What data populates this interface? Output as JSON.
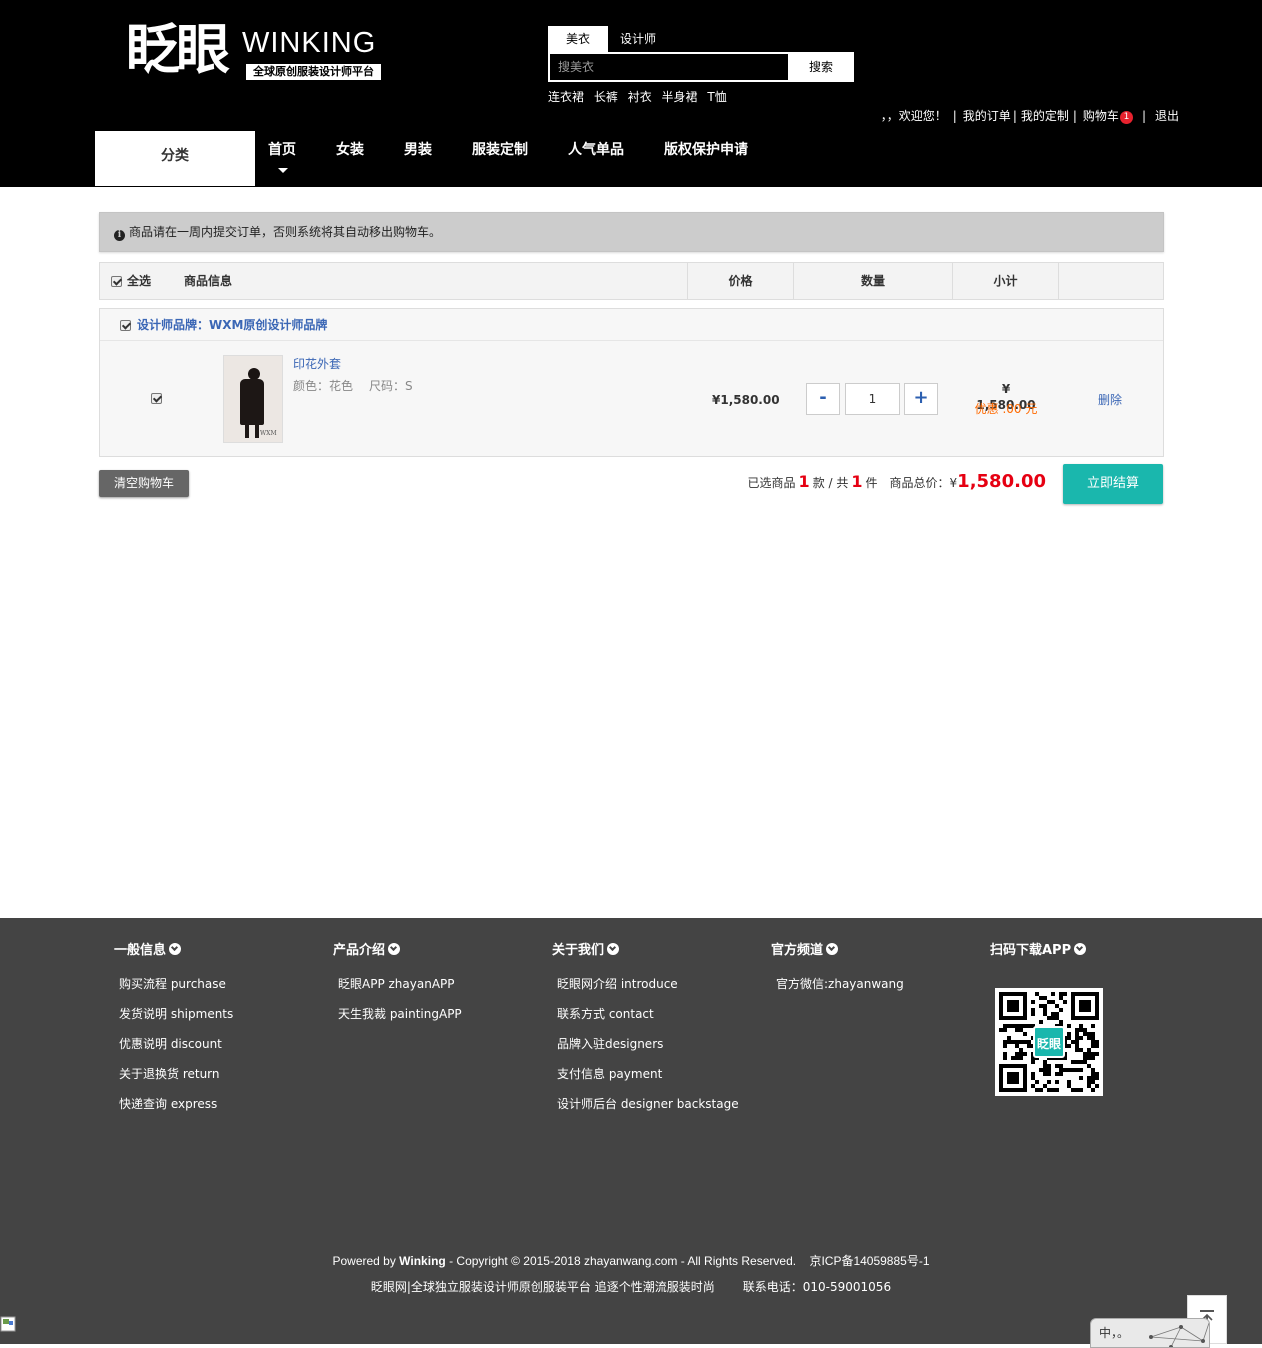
{
  "header": {
    "logo": {
      "cn": "眨眼",
      "en": "WINKING",
      "sub": "全球原创服装设计师平台"
    },
    "search": {
      "tabs": [
        "美衣",
        "设计师"
      ],
      "placeholder": "搜美衣",
      "button": "搜索",
      "hot_words": [
        "连衣裙",
        "长裤",
        "衬衣",
        "半身裙",
        "T恤"
      ]
    },
    "user_bar": {
      "welcome": "，，欢迎您！",
      "links": [
        "我的订单",
        "我的定制",
        "购物车",
        "退出"
      ],
      "cart_count": "1"
    },
    "nav": {
      "category": "分类",
      "items": [
        "首页",
        "女装",
        "男装",
        "服装定制",
        "人气单品",
        "版权保护申请"
      ]
    }
  },
  "cart": {
    "notice": "商品请在一周内提交订单，否则系统将其自动移出购物车。",
    "columns": {
      "select_all": "全选",
      "info": "商品信息",
      "price": "价格",
      "quantity": "数量",
      "subtotal": "小计"
    },
    "shop": {
      "name": "设计师品牌：WXM原创设计师品牌",
      "items": [
        {
          "name": "印花外套",
          "color": "颜色：花色",
          "size": "尺码：S",
          "price": "¥1,580.00",
          "quantity": "1",
          "subtotal": "¥ 1,580.00",
          "discount": "优惠 .00 元",
          "delete": "删除",
          "image_mark": "WXM"
        }
      ]
    },
    "qty_minus": "-",
    "qty_plus": "+",
    "clear_button": "清空购物车",
    "summary": {
      "selected_label": "已选商品",
      "selected_count": "1",
      "kinds_label": "款 / 共",
      "total_count": "1",
      "pieces_label": "件",
      "total_label": "商品总价：¥",
      "total_value": "1,580.00"
    },
    "checkout_button": "立即结算"
  },
  "footer": {
    "columns": [
      {
        "title": "一般信息",
        "links": [
          "购买流程 purchase",
          "发货说明 shipments",
          "优惠说明 discount",
          "关于退换货 return",
          "快递查询 express"
        ]
      },
      {
        "title": "产品介绍",
        "links": [
          "眨眼APP zhayanAPP",
          "天生我裁 paintingAPP"
        ]
      },
      {
        "title": "关于我们",
        "links": [
          "眨眼网介绍 introduce",
          "联系方式 contact",
          "品牌入驻designers",
          "支付信息 payment",
          "设计师后台 designer backstage"
        ]
      },
      {
        "title": "官方频道",
        "links": [
          "官方微信:zhayanwang"
        ]
      },
      {
        "title": "扫码下载APP",
        "links": []
      }
    ],
    "qr_label": "眨眼",
    "copyright": {
      "prefix": "Powered by ",
      "brand": "Winking",
      "rest": " - Copyright © 2015-2018 zhayanwang.com - All Rights Reserved.",
      "icp": "京ICP备14059885号-1"
    },
    "slogan": "眨眼网|全球独立服装设计师原创服装平台 追逐个性潮流服装时尚",
    "phone": "联系电话：010-59001056"
  },
  "ime": {
    "text": "中，。"
  }
}
